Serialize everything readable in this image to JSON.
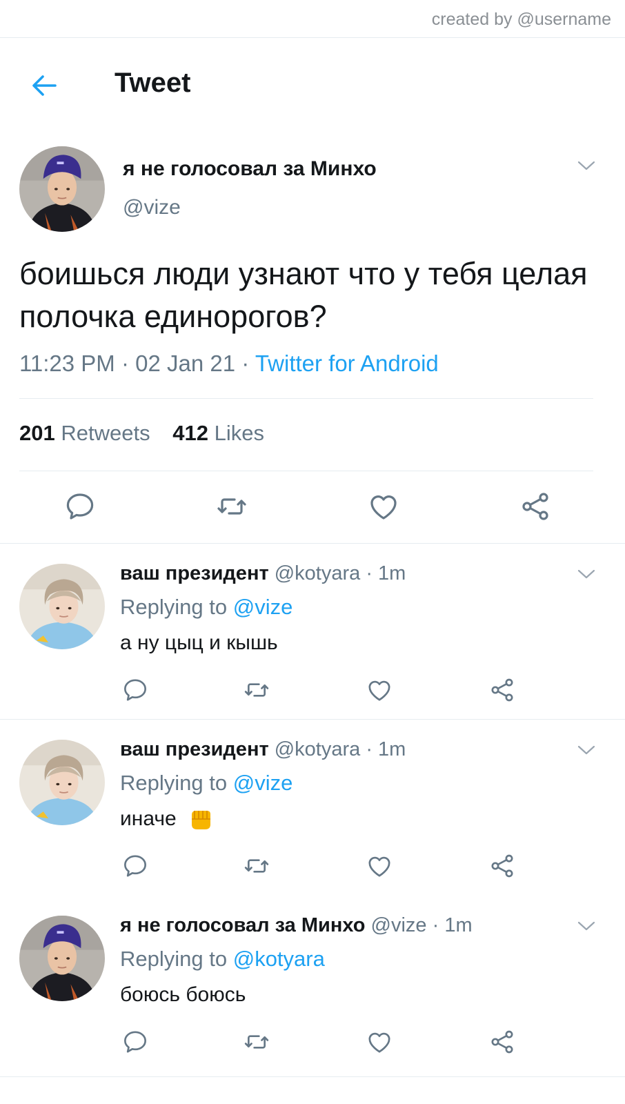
{
  "credit": "created by @username",
  "header": {
    "title": "Tweet"
  },
  "main_tweet": {
    "display_name": "я не голосовал за Минхо",
    "handle": "@vize",
    "text": "боишься люди узнают что у тебя целая полочка единорогов?",
    "time_date": "11:23 PM · 02 Jan 21 · ",
    "source": "Twitter for Android",
    "retweets_count": "201",
    "retweets_label": "Retweets",
    "likes_count": "412",
    "likes_label": "Likes"
  },
  "replies": [
    {
      "display_name": "ваш президент",
      "handle_time": "@kotyara · 1m",
      "replying_label": "Replying to",
      "replying_to": "@vize",
      "text": "а ну цыц и кышь"
    },
    {
      "display_name": "ваш президент",
      "handle_time": "@kotyara · 1m",
      "replying_label": "Replying to",
      "replying_to": "@vize",
      "text": "иначе"
    },
    {
      "display_name": "я не голосовал за Минхо",
      "handle_time": "@vize · 1m",
      "replying_label": "Replying to",
      "replying_to": "@kotyara",
      "text": "боюсь боюсь"
    }
  ],
  "icons": {
    "back": "arrow-left-icon",
    "reply": "speech-bubble-icon",
    "retweet": "retweet-icon",
    "like": "heart-icon",
    "share": "share-icon",
    "caret": "chevron-down-icon",
    "emoji": "oncoming-fist-emoji"
  },
  "colors": {
    "accent": "#1da1f2",
    "muted": "#657786",
    "text": "#14171a",
    "divider": "#e6ecf0"
  }
}
